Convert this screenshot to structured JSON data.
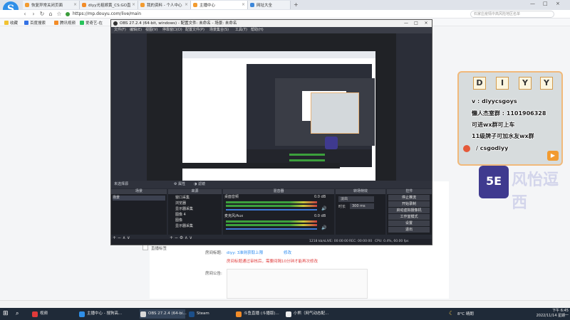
{
  "tabs": [
    {
      "label": "恢复异常关闭页面"
    },
    {
      "label": "diyy光祖嫁黄_CS:GO直"
    },
    {
      "label": "我的资料 - 个人中心"
    },
    {
      "label": "主播中心"
    },
    {
      "label": "网址大全"
    }
  ],
  "address": {
    "url": "https://mp.douyu.com/live/main",
    "search_placeholder": "石家庄疫情中高风险地区名单"
  },
  "favorites": [
    "收藏",
    "百度搜索",
    "腾讯视频",
    "爱奇艺-在"
  ],
  "page": {
    "topic_label": "房间标题:",
    "topic_value": "diyy: 3准则获取上限",
    "topic_action": "修改",
    "notice": "房间标题通过审核后，需要间隔10分钟才能再次修改",
    "announce_label": "房间公告:",
    "live_label": "直播标签"
  },
  "obs": {
    "title": "OBS 27.2.4 (64-bit, windows) - 配置文件: 未命名 - 场景: 未命名",
    "menu": [
      "文件(F)",
      "编辑(E)",
      "视图(V)",
      "停靠窗口(D)",
      "配置文件(P)",
      "场景集合(S)",
      "工具(T)",
      "帮助(H)"
    ],
    "no_source": "未选择源",
    "props_label": "属性",
    "filters_label": "滤镜",
    "docks": {
      "scenes": "场景",
      "sources": "来源",
      "mixer": "混音器",
      "transitions": "转场特效",
      "controls": "控件"
    },
    "scene_items": [
      "场景"
    ],
    "source_items": [
      "窗口采集",
      "浏览器",
      "显示器采集",
      "图像 4",
      "图像",
      "显示器采集"
    ],
    "mixer_items": [
      {
        "name": "桌面音频",
        "db": "0.0 dB"
      },
      {
        "name": "麦克风/Aux",
        "db": "0.0 dB"
      }
    ],
    "transition": {
      "type": "淡出",
      "duration_label": "时长",
      "duration": "300 ms"
    },
    "controls": [
      "停止推流",
      "开始录制",
      "启动虚拟摄像机",
      "工作室模式",
      "设置",
      "退出"
    ],
    "status": {
      "live": "LIVE: 00:00:00",
      "rec": "REC: 00:00:00",
      "cpu": "CPU: 0.4%, 60.00 fps",
      "kbps": "1218 kb/s"
    }
  },
  "overlay": {
    "letters": [
      "D",
      "I",
      "Y",
      "Y"
    ],
    "lines": [
      "v : diyycsgoys",
      "懒人杰室群 : 1101906328",
      "可进wx群可上车",
      "11级牌子可加水友wx群",
      "/ csgodiyy"
    ],
    "badge": "5E",
    "watermark": "风怡逗西"
  },
  "taskbar": {
    "items": [
      "视频",
      "主播中心 - 搜狗高...",
      "OBS 27.2.4 (64-bi...",
      "Steam",
      "斗鱼直播 (斗播版)...",
      "小熊（网气动态配..."
    ],
    "weather": "8°C 晴朗",
    "time": "下午 6:45",
    "date": "2022/11/14 星期一"
  },
  "colors": {
    "accent": "#2d8cf0",
    "notice": "#e04040",
    "obs_bg": "#2b2e38",
    "card_border": "#f1b97a",
    "badge": "#3f3a8f"
  }
}
